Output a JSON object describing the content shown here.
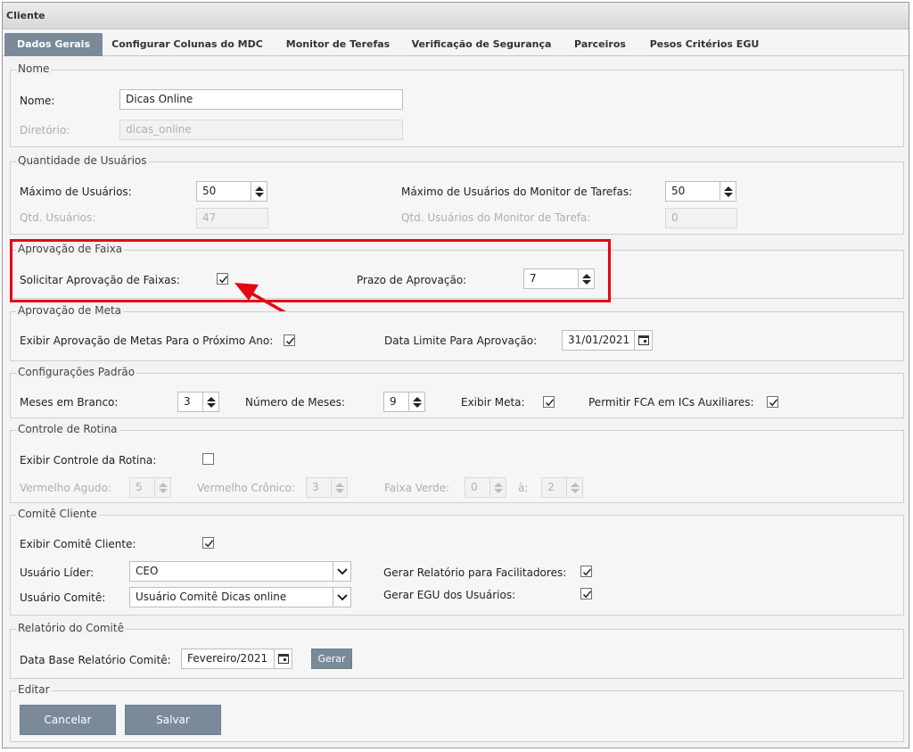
{
  "window": {
    "title": "Cliente"
  },
  "tabs": [
    {
      "label": "Dados Gerais"
    },
    {
      "label": "Configurar Colunas do MDC"
    },
    {
      "label": "Monitor de Terefas"
    },
    {
      "label": "Verificação de Segurança"
    },
    {
      "label": "Parceiros"
    },
    {
      "label": "Pesos Critérios EGU"
    }
  ],
  "nome": {
    "legend": "Nome",
    "nome_label": "Nome:",
    "nome_value": "Dicas Online",
    "diretorio_label": "Diretório:",
    "diretorio_value": "dicas_online"
  },
  "usuarios": {
    "legend": "Quantidade de Usuários",
    "max_label": "Máximo de Usuários:",
    "max_value": "50",
    "max_monitor_label": "Máximo de Usuários do Monitor de Tarefas:",
    "max_monitor_value": "50",
    "qtd_label": "Qtd. Usuários:",
    "qtd_value": "47",
    "qtd_monitor_label": "Qtd. Usuários do Monitor de Tarefa:",
    "qtd_monitor_value": "0"
  },
  "faixa": {
    "legend": "Aprovação de Faixa",
    "solicitar_label": "Solicitar Aprovação de Faixas:",
    "solicitar_checked": true,
    "prazo_label": "Prazo de Aprovação:",
    "prazo_value": "7"
  },
  "meta": {
    "legend": "Aprovação de Meta",
    "exibir_label": "Exibir Aprovação de Metas Para o Próximo Ano:",
    "exibir_checked": true,
    "data_limite_label": "Data Limite Para Aprovação:",
    "data_limite_value": "31/01/2021"
  },
  "padrao": {
    "legend": "Configurações Padrão",
    "meses_branco_label": "Meses em Branco:",
    "meses_branco_value": "3",
    "numero_meses_label": "Número de Meses:",
    "numero_meses_value": "9",
    "exibir_meta_label": "Exibir Meta:",
    "exibir_meta_checked": true,
    "permitir_fca_label": "Permitir FCA em ICs Auxiliares:",
    "permitir_fca_checked": true
  },
  "rotina": {
    "legend": "Controle de Rotina",
    "exibir_label": "Exibir Controle da Rotina:",
    "exibir_checked": false,
    "vermelho_agudo_label": "Vermelho Agudo:",
    "vermelho_agudo_value": "5",
    "vermelho_cronico_label": "Vermelho Crônico:",
    "vermelho_cronico_value": "3",
    "faixa_verde_label": "Faixa Verde:",
    "faixa_verde_from": "0",
    "a_label": "à:",
    "faixa_verde_to": "2"
  },
  "comite": {
    "legend": "Comitê Cliente",
    "exibir_label": "Exibir Comitê Cliente:",
    "exibir_checked": true,
    "lider_label": "Usuário Líder:",
    "lider_value": "CEO",
    "comite_label": "Usuário Comitê:",
    "comite_value": "Usuário Comitê Dicas online",
    "relatorio_fac_label": "Gerar Relatório para Facilitadores:",
    "relatorio_fac_checked": true,
    "egu_label": "Gerar EGU dos Usuários:",
    "egu_checked": true
  },
  "relatorio": {
    "legend": "Relatório do Comitê",
    "data_base_label": "Data Base Relatório Comitê:",
    "data_base_value": "Fevereiro/2021",
    "gerar_label": "Gerar"
  },
  "editar": {
    "legend": "Editar",
    "cancelar_label": "Cancelar",
    "salvar_label": "Salvar"
  },
  "colors": {
    "highlight": "#e30613",
    "tab_active": "#7b8a99",
    "button": "#7b8a99"
  }
}
